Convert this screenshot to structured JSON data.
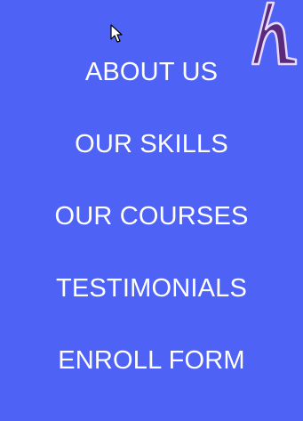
{
  "menu": {
    "items": [
      {
        "label": "ABOUT US"
      },
      {
        "label": "OUR SKILLS"
      },
      {
        "label": "OUR COURSES"
      },
      {
        "label": "TESTIMONIALS"
      },
      {
        "label": "ENROLL FORM"
      }
    ]
  },
  "colors": {
    "background": "#4e63f5",
    "text": "#ffffff",
    "logo_fill": "#5a2a7d",
    "logo_stroke": "#e9d9ff"
  },
  "icons": {
    "logo": "h-logo-icon",
    "cursor": "arrow-cursor-icon"
  }
}
